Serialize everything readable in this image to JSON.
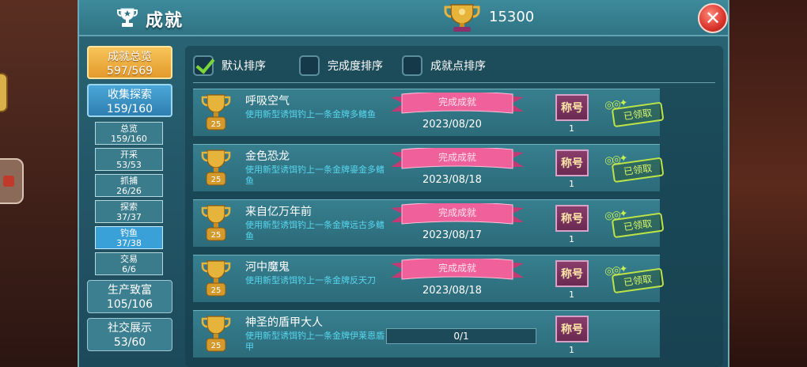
{
  "header": {
    "title": "成就",
    "score": "15300",
    "close_label": "✕"
  },
  "nav": {
    "overview": {
      "label": "成就总览",
      "count": "597/569"
    },
    "collect": {
      "label": "收集探索",
      "count": "159/160"
    },
    "subs": [
      {
        "label": "总览",
        "count": "159/160",
        "active": false
      },
      {
        "label": "开采",
        "count": "53/53",
        "active": false
      },
      {
        "label": "抓捕",
        "count": "26/26",
        "active": false
      },
      {
        "label": "探索",
        "count": "37/37",
        "active": false
      },
      {
        "label": "钓鱼",
        "count": "37/38",
        "active": true
      },
      {
        "label": "交易",
        "count": "6/6",
        "active": false
      }
    ],
    "produce": {
      "label": "生产致富",
      "count": "105/106"
    },
    "social": {
      "label": "社交展示",
      "count": "53/60"
    }
  },
  "sort": {
    "default": "默认排序",
    "completion": "完成度排序",
    "points": "成就点排序"
  },
  "achievements": [
    {
      "title": "呼吸空气",
      "desc": "使用新型诱饵钓上一条金牌多鳍鱼",
      "points": "25",
      "status": "完成成就",
      "date": "2023/08/20",
      "badge": "称号",
      "badge_count": "1",
      "claimed": "已领取"
    },
    {
      "title": "金色恐龙",
      "desc": "使用新型诱饵钓上一条金牌鎏金多鳍鱼",
      "points": "25",
      "status": "完成成就",
      "date": "2023/08/18",
      "badge": "称号",
      "badge_count": "1",
      "claimed": "已领取"
    },
    {
      "title": "来自亿万年前",
      "desc": "使用新型诱饵钓上一条金牌远古多鳍鱼",
      "points": "25",
      "status": "完成成就",
      "date": "2023/08/17",
      "badge": "称号",
      "badge_count": "1",
      "claimed": "已领取"
    },
    {
      "title": "河中魔鬼",
      "desc": "使用新型诱饵钓上一条金牌反天刀",
      "points": "25",
      "status": "完成成就",
      "date": "2023/08/18",
      "badge": "称号",
      "badge_count": "1",
      "claimed": "已领取"
    },
    {
      "title": "神圣的盾甲大人",
      "desc": "使用新型诱饵钓上一条金牌伊莱恩盾甲",
      "points": "25",
      "progress_text": "0/1",
      "progress": 0,
      "badge": "称号",
      "badge_count": "1"
    }
  ]
}
